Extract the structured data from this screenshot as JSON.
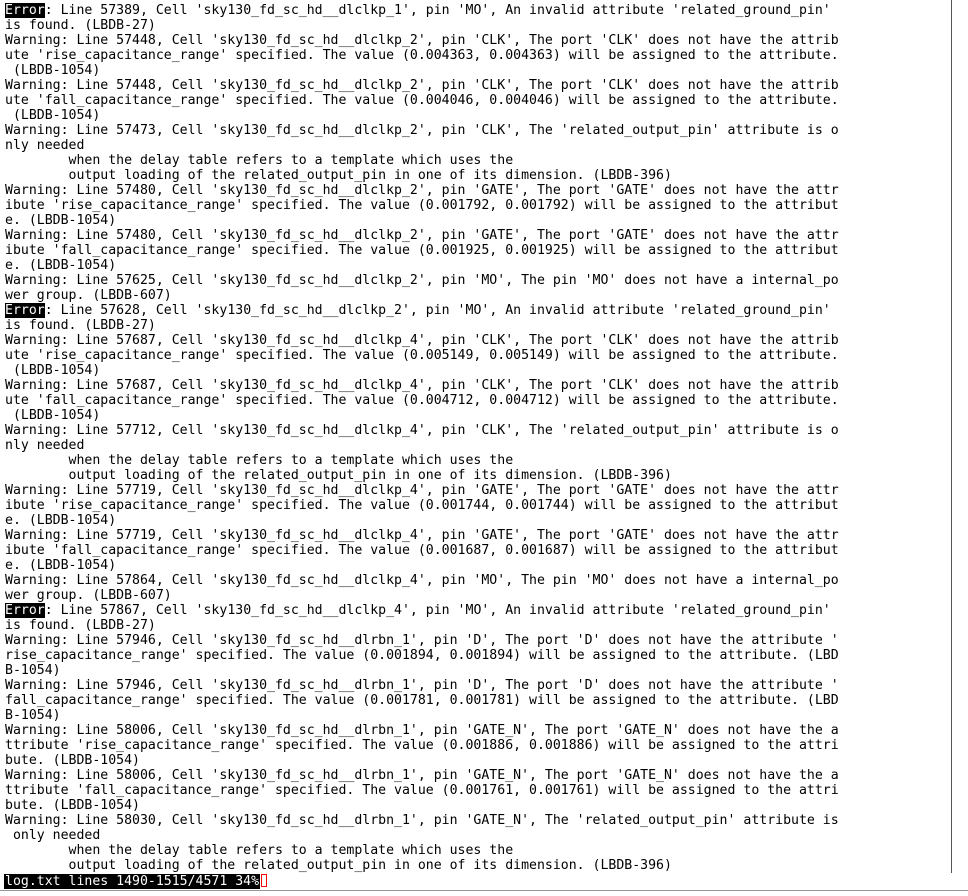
{
  "colors": {
    "background": "#ffffff",
    "text": "#000000",
    "error_highlight_bg": "#000000",
    "error_highlight_fg": "#ffffff",
    "cursor": "#ff0000"
  },
  "status_bar": {
    "text": "log.txt lines 1490-1515/4571 34%"
  },
  "lines": [
    {
      "tag": "Error",
      "text": ": Line 57389, Cell 'sky130_fd_sc_hd__dlclkp_1', pin 'MO', An invalid attribute 'related_ground_pin'"
    },
    {
      "text": "is found. (LBDB-27)"
    },
    {
      "text": "Warning: Line 57448, Cell 'sky130_fd_sc_hd__dlclkp_2', pin 'CLK', The port 'CLK' does not have the attrib"
    },
    {
      "text": "ute 'rise_capacitance_range' specified. The value (0.004363, 0.004363) will be assigned to the attribute."
    },
    {
      "text": " (LBDB-1054)"
    },
    {
      "text": "Warning: Line 57448, Cell 'sky130_fd_sc_hd__dlclkp_2', pin 'CLK', The port 'CLK' does not have the attrib"
    },
    {
      "text": "ute 'fall_capacitance_range' specified. The value (0.004046, 0.004046) will be assigned to the attribute."
    },
    {
      "text": " (LBDB-1054)"
    },
    {
      "text": "Warning: Line 57473, Cell 'sky130_fd_sc_hd__dlclkp_2', pin 'CLK', The 'related_output_pin' attribute is o"
    },
    {
      "text": "nly needed"
    },
    {
      "text": "        when the delay table refers to a template which uses the"
    },
    {
      "text": "        output loading of the related_output_pin in one of its dimension. (LBDB-396)"
    },
    {
      "text": "Warning: Line 57480, Cell 'sky130_fd_sc_hd__dlclkp_2', pin 'GATE', The port 'GATE' does not have the attr"
    },
    {
      "text": "ibute 'rise_capacitance_range' specified. The value (0.001792, 0.001792) will be assigned to the attribut"
    },
    {
      "text": "e. (LBDB-1054)"
    },
    {
      "text": "Warning: Line 57480, Cell 'sky130_fd_sc_hd__dlclkp_2', pin 'GATE', The port 'GATE' does not have the attr"
    },
    {
      "text": "ibute 'fall_capacitance_range' specified. The value (0.001925, 0.001925) will be assigned to the attribut"
    },
    {
      "text": "e. (LBDB-1054)"
    },
    {
      "text": "Warning: Line 57625, Cell 'sky130_fd_sc_hd__dlclkp_2', pin 'MO', The pin 'MO' does not have a internal_po"
    },
    {
      "text": "wer group. (LBDB-607)"
    },
    {
      "tag": "Error",
      "text": ": Line 57628, Cell 'sky130_fd_sc_hd__dlclkp_2', pin 'MO', An invalid attribute 'related_ground_pin'"
    },
    {
      "text": "is found. (LBDB-27)"
    },
    {
      "text": "Warning: Line 57687, Cell 'sky130_fd_sc_hd__dlclkp_4', pin 'CLK', The port 'CLK' does not have the attrib"
    },
    {
      "text": "ute 'rise_capacitance_range' specified. The value (0.005149, 0.005149) will be assigned to the attribute."
    },
    {
      "text": " (LBDB-1054)"
    },
    {
      "text": "Warning: Line 57687, Cell 'sky130_fd_sc_hd__dlclkp_4', pin 'CLK', The port 'CLK' does not have the attrib"
    },
    {
      "text": "ute 'fall_capacitance_range' specified. The value (0.004712, 0.004712) will be assigned to the attribute."
    },
    {
      "text": " (LBDB-1054)"
    },
    {
      "text": "Warning: Line 57712, Cell 'sky130_fd_sc_hd__dlclkp_4', pin 'CLK', The 'related_output_pin' attribute is o"
    },
    {
      "text": "nly needed"
    },
    {
      "text": "        when the delay table refers to a template which uses the"
    },
    {
      "text": "        output loading of the related_output_pin in one of its dimension. (LBDB-396)"
    },
    {
      "text": "Warning: Line 57719, Cell 'sky130_fd_sc_hd__dlclkp_4', pin 'GATE', The port 'GATE' does not have the attr"
    },
    {
      "text": "ibute 'rise_capacitance_range' specified. The value (0.001744, 0.001744) will be assigned to the attribut"
    },
    {
      "text": "e. (LBDB-1054)"
    },
    {
      "text": "Warning: Line 57719, Cell 'sky130_fd_sc_hd__dlclkp_4', pin 'GATE', The port 'GATE' does not have the attr"
    },
    {
      "text": "ibute 'fall_capacitance_range' specified. The value (0.001687, 0.001687) will be assigned to the attribut"
    },
    {
      "text": "e. (LBDB-1054)"
    },
    {
      "text": "Warning: Line 57864, Cell 'sky130_fd_sc_hd__dlclkp_4', pin 'MO', The pin 'MO' does not have a internal_po"
    },
    {
      "text": "wer group. (LBDB-607)"
    },
    {
      "tag": "Error",
      "text": ": Line 57867, Cell 'sky130_fd_sc_hd__dlclkp_4', pin 'MO', An invalid attribute 'related_ground_pin'"
    },
    {
      "text": "is found. (LBDB-27)"
    },
    {
      "text": "Warning: Line 57946, Cell 'sky130_fd_sc_hd__dlrbn_1', pin 'D', The port 'D' does not have the attribute '"
    },
    {
      "text": "rise_capacitance_range' specified. The value (0.001894, 0.001894) will be assigned to the attribute. (LBD"
    },
    {
      "text": "B-1054)"
    },
    {
      "text": "Warning: Line 57946, Cell 'sky130_fd_sc_hd__dlrbn_1', pin 'D', The port 'D' does not have the attribute '"
    },
    {
      "text": "fall_capacitance_range' specified. The value (0.001781, 0.001781) will be assigned to the attribute. (LBD"
    },
    {
      "text": "B-1054)"
    },
    {
      "text": "Warning: Line 58006, Cell 'sky130_fd_sc_hd__dlrbn_1', pin 'GATE_N', The port 'GATE_N' does not have the a"
    },
    {
      "text": "ttribute 'rise_capacitance_range' specified. The value (0.001886, 0.001886) will be assigned to the attri"
    },
    {
      "text": "bute. (LBDB-1054)"
    },
    {
      "text": "Warning: Line 58006, Cell 'sky130_fd_sc_hd__dlrbn_1', pin 'GATE_N', The port 'GATE_N' does not have the a"
    },
    {
      "text": "ttribute 'fall_capacitance_range' specified. The value (0.001761, 0.001761) will be assigned to the attri"
    },
    {
      "text": "bute. (LBDB-1054)"
    },
    {
      "text": "Warning: Line 58030, Cell 'sky130_fd_sc_hd__dlrbn_1', pin 'GATE_N', The 'related_output_pin' attribute is"
    },
    {
      "text": " only needed"
    },
    {
      "text": "        when the delay table refers to a template which uses the"
    },
    {
      "text": "        output loading of the related_output_pin in one of its dimension. (LBDB-396)"
    }
  ]
}
